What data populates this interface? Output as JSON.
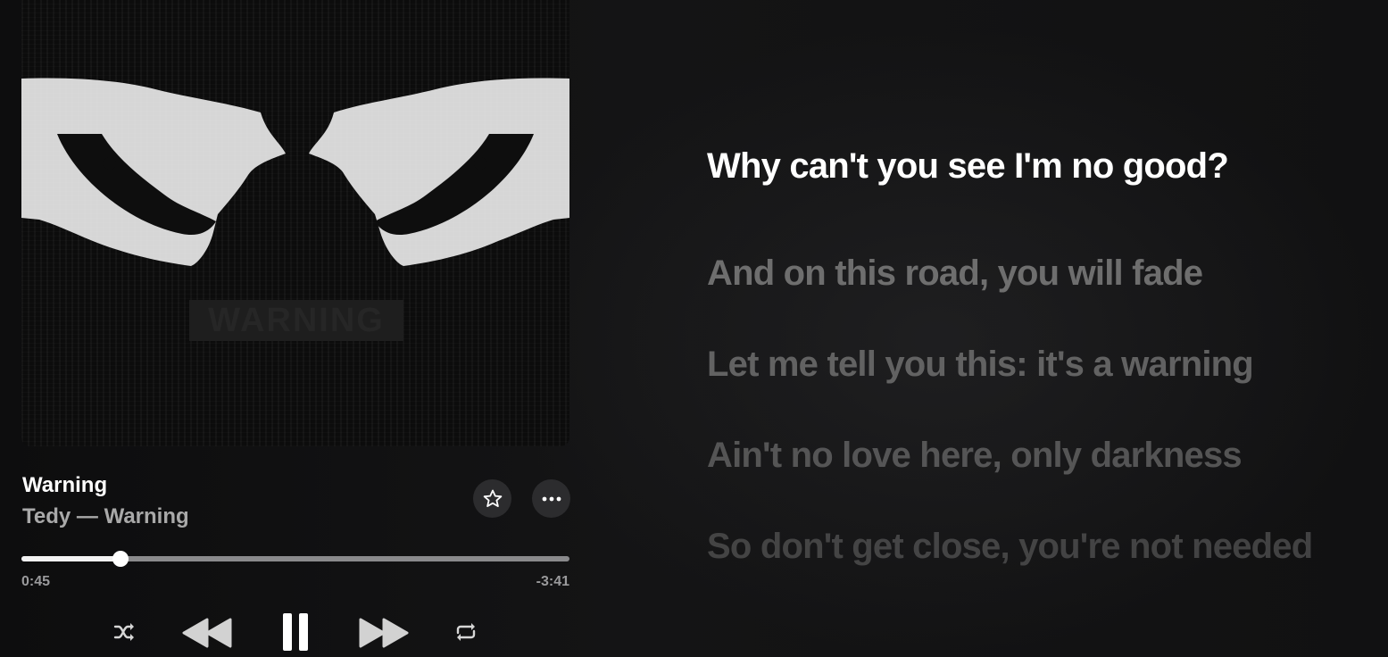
{
  "track": {
    "title": "Warning",
    "subtitle": "Tedy — Warning",
    "album_art_text": "WARNING"
  },
  "progress": {
    "elapsed": "0:45",
    "remaining": "-3:41",
    "fraction": 0.18
  },
  "buttons": {
    "favorite_icon": "star-outline-icon",
    "more_icon": "ellipsis-icon",
    "shuffle_icon": "shuffle-icon",
    "previous_icon": "rewind-icon",
    "pause_icon": "pause-icon",
    "next_icon": "fast-forward-icon",
    "repeat_icon": "repeat-icon"
  },
  "lyrics": {
    "lines": [
      "Why can't you see I'm no good?",
      "And on this road, you will fade",
      "Let me tell you this: it's a warning",
      "Ain't no love here, only darkness",
      "So don't get close, you're not needed"
    ],
    "active_index": 0
  },
  "colors": {
    "active_lyric": "#ffffff",
    "inactive_lyric": "#6e6e6e"
  }
}
